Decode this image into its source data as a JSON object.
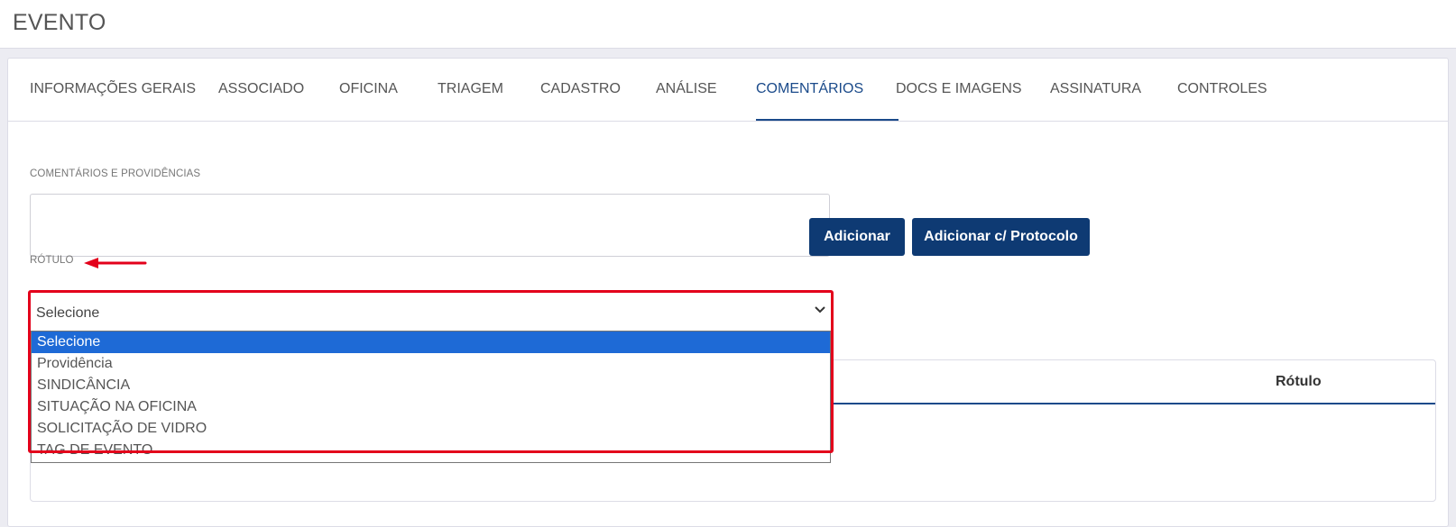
{
  "page": {
    "title": "EVENTO"
  },
  "tabs": [
    {
      "label": "INFORMAÇÕES GERAIS"
    },
    {
      "label": "ASSOCIADO"
    },
    {
      "label": "OFICINA"
    },
    {
      "label": "TRIAGEM"
    },
    {
      "label": "CADASTRO"
    },
    {
      "label": "ANÁLISE"
    },
    {
      "label": "COMENTÁRIOS",
      "active": true
    },
    {
      "label": "DOCS E IMAGENS"
    },
    {
      "label": "ASSINATURA"
    },
    {
      "label": "CONTROLES"
    }
  ],
  "form": {
    "comments_label": "COMENTÁRIOS E PROVIDÊNCIAS",
    "comments_value": "",
    "add_button": "Adicionar",
    "add_protocol_button": "Adicionar c/ Protocolo",
    "rotulo_label": "RÓTULO",
    "select": {
      "value": "Selecione",
      "options": [
        "Selecione",
        "Providência",
        "SINDICÂNCIA",
        "SITUAÇÃO NA OFICINA",
        "SOLICITAÇÃO DE VIDRO",
        "TAG DE EVENTO"
      ],
      "selected_index": 0
    }
  },
  "table": {
    "column_rotulo": "Rótulo"
  },
  "annotations": {
    "arrow_color": "#e3001b",
    "frame_color": "#e3001b"
  },
  "colors": {
    "primary": "#0e3a73",
    "tab_active": "#1a4a8a",
    "option_highlight": "#1e6ad6"
  }
}
